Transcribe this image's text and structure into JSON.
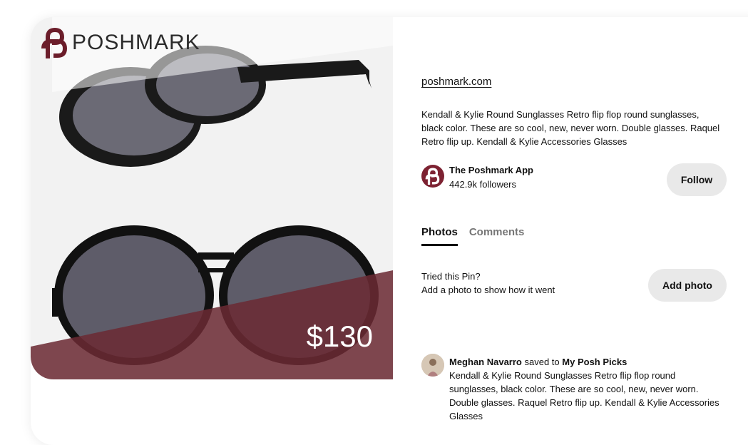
{
  "pin": {
    "brand": "POSHMARK",
    "price": "$130",
    "source_link": "poshmark.com",
    "description": "Kendall & Kylie Round Sunglasses Retro flip flop round sunglasses, black color. These are so cool, new, never worn. Double glasses. Raquel Retro flip up. Kendall & Kylie Accessories Glasses"
  },
  "creator": {
    "name": "The Poshmark App",
    "followers": "442.9k followers",
    "follow_label": "Follow"
  },
  "tabs": [
    {
      "label": "Photos",
      "active": true
    },
    {
      "label": "Comments",
      "active": false
    }
  ],
  "tried": {
    "title": "Tried this Pin?",
    "subtitle": "Add a photo to show how it went",
    "button_label": "Add photo"
  },
  "activity": {
    "user": "Meghan Navarro",
    "action": "saved to",
    "board": "My Posh Picks",
    "text": "Kendall & Kylie Round Sunglasses Retro flip flop round sunglasses, black color. These are so cool, new, never worn. Double glasses. Raquel Retro flip up. Kendall & Kylie Accessories Glasses"
  },
  "colors": {
    "brand_maroon": "#7d2232",
    "price_band": "#6b2a33",
    "button_bg": "#e9e9e9"
  }
}
